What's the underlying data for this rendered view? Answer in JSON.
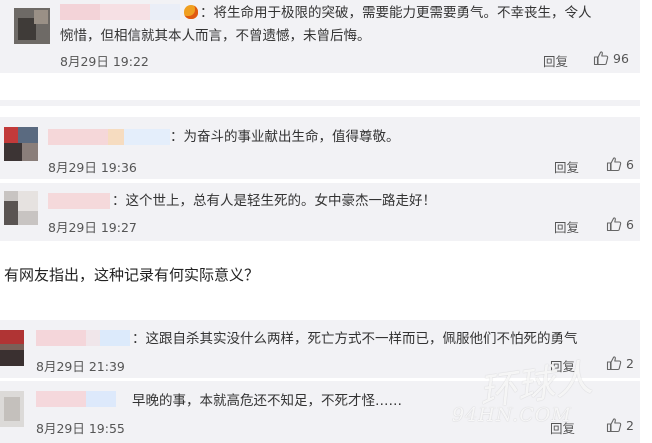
{
  "comments": [
    {
      "text_line1": "：将生命用于极限的突破，需要能力更需要勇气。不幸丧生，令人",
      "text_line2": "惋惜，但相信就其本人而言，不曾遗憾，未曾后悔。",
      "time": "8月29日 19:22",
      "reply": "回复",
      "likes": "96"
    },
    {
      "text": "：为奋斗的事业献出生命，值得尊敬。",
      "time": "8月29日 19:36",
      "reply": "回复",
      "likes": "6"
    },
    {
      "text": "：这个世上，总有人是轻生死的。女中豪杰一路走好！",
      "time": "8月29日 19:27",
      "reply": "回复",
      "likes": "6"
    },
    {
      "text": "：这跟自杀其实没什么两样，死亡方式不一样而已，佩服他们不怕死的勇气",
      "time": "8月29日 21:39",
      "reply": "回复",
      "likes": "2"
    },
    {
      "text": "早晚的事，本就高危还不知足，不死才怪……",
      "time": "8月29日 19:55",
      "reply": "回复",
      "likes": "2"
    }
  ],
  "section_heading": "有网友指出，这种记录有何实际意义？",
  "watermark": {
    "line1": "环球人",
    "line2": "94HN.COM"
  },
  "colors": {
    "card_bg": "#f2f2f5",
    "accent_emoji": "#f0a020"
  },
  "icons": {
    "like": "thumbs-up-icon",
    "emoji": "fire-emoji-icon"
  }
}
